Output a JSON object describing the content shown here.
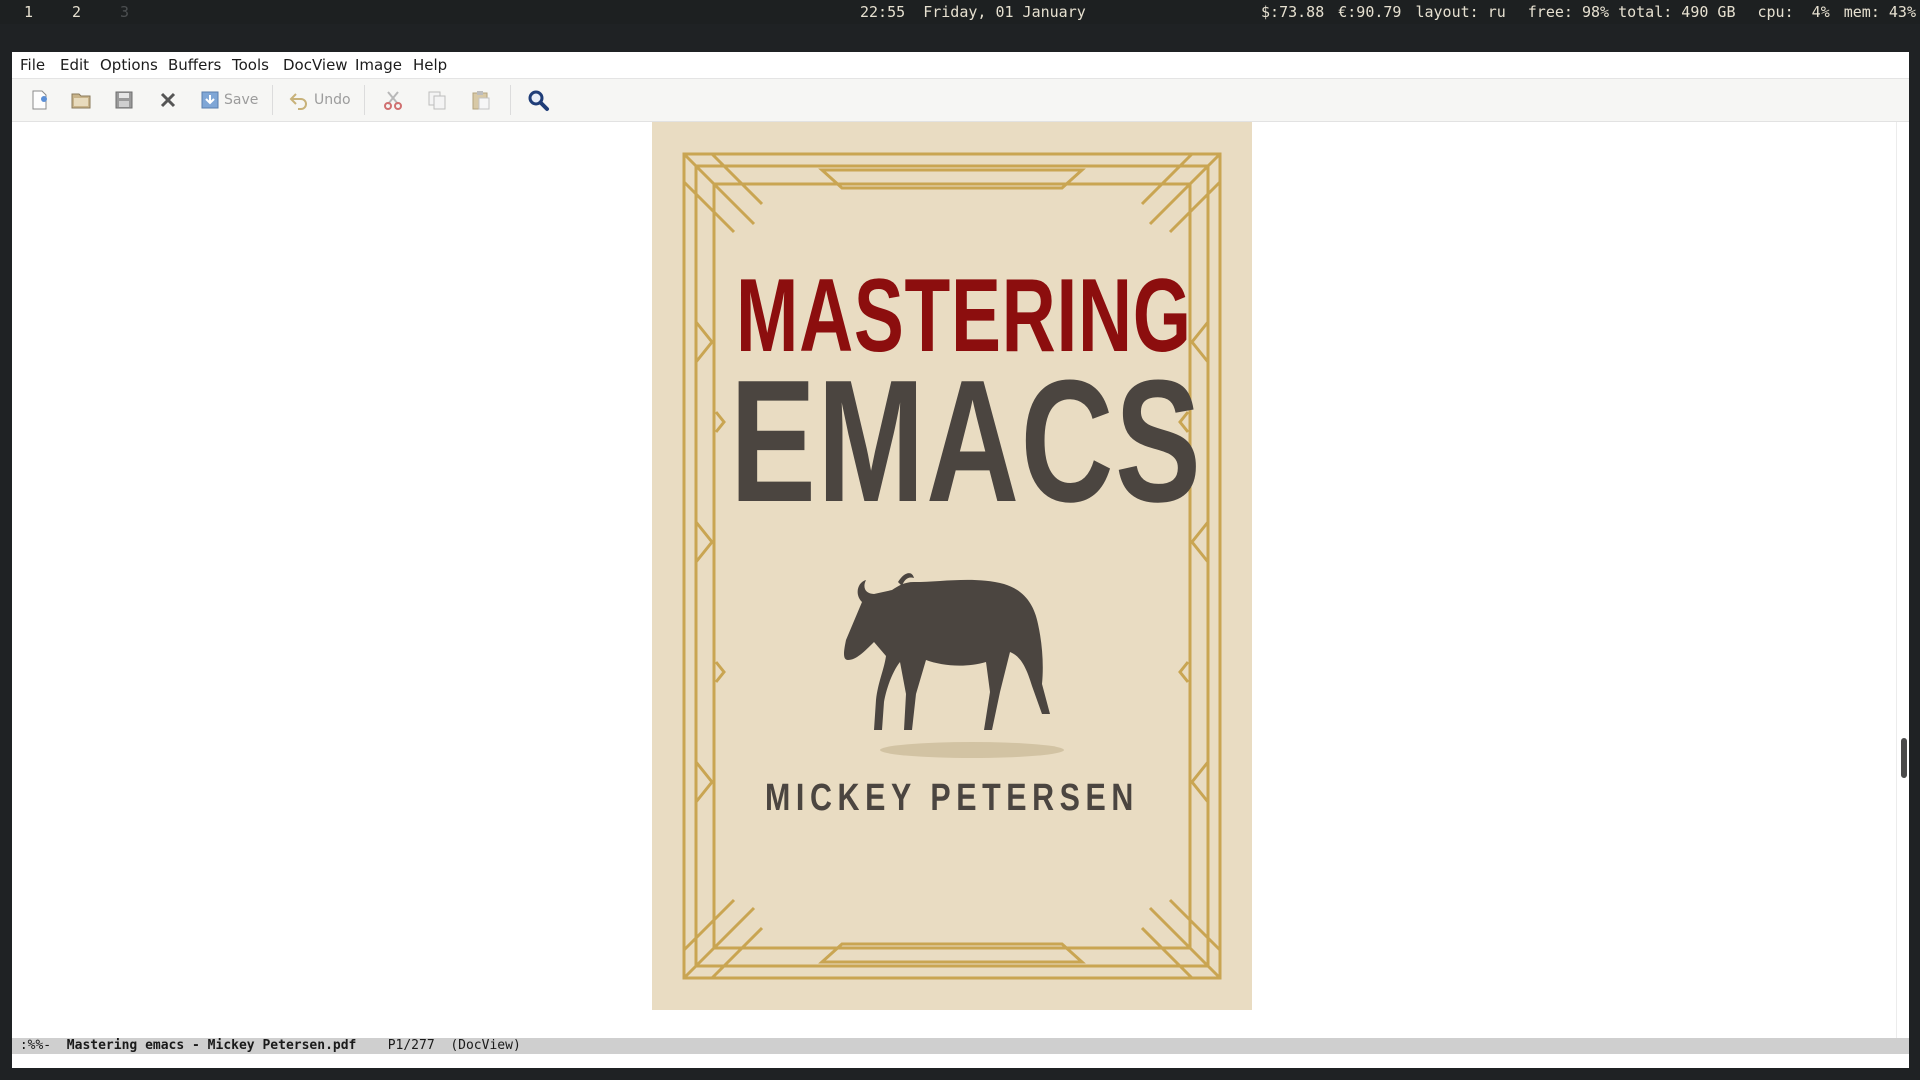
{
  "topbar": {
    "workspaces": [
      {
        "label": "1",
        "active": true
      },
      {
        "label": "2",
        "active": true
      },
      {
        "label": "3",
        "active": false
      }
    ],
    "time": "22:55",
    "date": "Friday, 01 January",
    "usd": "$:73.88",
    "eur": "€:90.79",
    "layout": "layout: ru",
    "disk": "free: 98% total: 490 GB",
    "cpu": "cpu:  4%",
    "mem": "mem: 43%"
  },
  "menubar": {
    "items": [
      "File",
      "Edit",
      "Options",
      "Buffers",
      "Tools",
      "DocView",
      "Image",
      "Help"
    ]
  },
  "toolbar": {
    "save_label": "Save",
    "undo_label": "Undo",
    "icons": [
      "new-file-icon",
      "open-folder-icon",
      "save-disk-icon",
      "close-icon",
      "save-icon",
      "undo-icon",
      "cut-icon",
      "copy-icon",
      "paste-icon",
      "search-icon"
    ]
  },
  "document": {
    "cover_title_line1": "MASTERING",
    "cover_title_line2": "EMACS",
    "cover_author": "MICKEY PETERSEN",
    "colors": {
      "page_bg": "#e9dcc2",
      "border_gold": "#c9a552",
      "title_red": "#8c0e0e",
      "title_dark": "#4b4540"
    }
  },
  "modeline": {
    "status": ":%%-",
    "buffer_name": "Mastering emacs - Mickey Petersen.pdf",
    "position": "P1/277",
    "mode": "(DocView)"
  }
}
